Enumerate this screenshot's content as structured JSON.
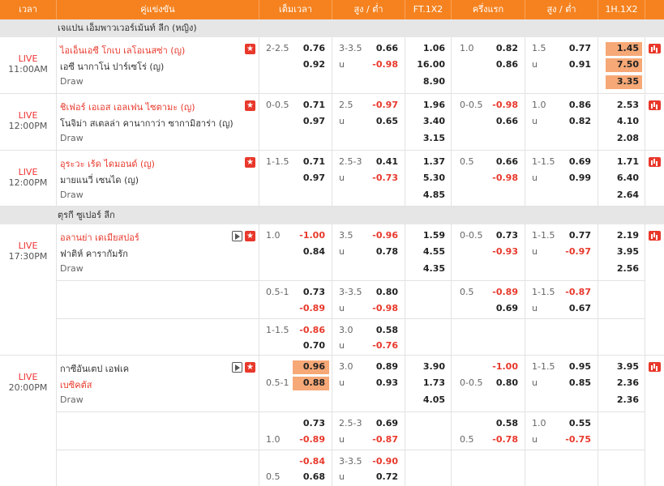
{
  "header": {
    "time": "เวลา",
    "match": "คู่แข่งขัน",
    "handicap": "เต็มเวลา",
    "ou": "สูง / ต่ำ",
    "ft1x2": "FT.1X2",
    "half": "ครึ่งแรก",
    "ou_half": "สูง / ต่ำ",
    "h1x2": "1H.1X2"
  },
  "leagues": [
    "เจแปน เอ็มพาวเวอร์เม้นท์ ลีก (หญิง)",
    "ตุรกี ซูเปอร์ ลีก"
  ],
  "live": "LIVE",
  "draw": "Draw",
  "under": "u",
  "m1": {
    "time": "11:00AM",
    "home": "ไอเอ็นเอซี โกเบ เลโอเนสซ่า (ญ)",
    "away": "เอซี นากาโน่ ปาร์เซโร่ (ญ)",
    "hdp": "2-2.5",
    "hdp_h": "0.76",
    "hdp_a": "0.92",
    "ou": "3-3.5",
    "ou_o": "0.66",
    "ou_u": "-0.98",
    "ft_h": "1.06",
    "ft_a": "16.00",
    "ft_d": "8.90",
    "hhdp": "1.0",
    "hhdp_h": "0.82",
    "hhdp_a": "0.86",
    "hou": "1.5",
    "hou_o": "0.77",
    "hou_u": "0.91",
    "h_h": "1.45",
    "h_a": "7.50",
    "h_d": "3.35"
  },
  "m2": {
    "time": "12:00PM",
    "home": "ชิเฟอร์ เอเอส เอลเฟน ไซตามะ (ญ)",
    "away": "โนจิม่า สเตลล่า คานากาว่า ซากามิฮาร่า (ญ)",
    "hdp": "0-0.5",
    "hdp_h": "0.71",
    "hdp_a": "0.97",
    "ou": "2.5",
    "ou_o": "-0.97",
    "ou_u": "0.65",
    "ft_h": "1.96",
    "ft_a": "3.40",
    "ft_d": "3.15",
    "hhdp": "0-0.5",
    "hhdp_h": "-0.98",
    "hhdp_a": "0.66",
    "hou": "1.0",
    "hou_o": "0.86",
    "hou_u": "0.82",
    "h_h": "2.53",
    "h_a": "4.10",
    "h_d": "2.08"
  },
  "m3": {
    "time": "12:00PM",
    "home": "อุระวะ เร้ด ไดมอนด์ (ญ)",
    "away": "มายแนวี่ เซนได (ญ)",
    "hdp": "1-1.5",
    "hdp_h": "0.71",
    "hdp_a": "0.97",
    "ou": "2.5-3",
    "ou_o": "0.41",
    "ou_u": "-0.73",
    "ft_h": "1.37",
    "ft_a": "5.30",
    "ft_d": "4.85",
    "hhdp": "0.5",
    "hhdp_h": "0.66",
    "hhdp_a": "-0.98",
    "hou": "1-1.5",
    "hou_o": "0.69",
    "hou_u": "0.99",
    "h_h": "1.71",
    "h_a": "6.40",
    "h_d": "2.64"
  },
  "m4": {
    "time": "17:30PM",
    "home": "อลานย่า เดเมียสปอร์",
    "away": "ฟาติห์ คารากัมรัก",
    "hdp": "1.0",
    "hdp_h": "-1.00",
    "hdp_a": "0.84",
    "ou": "3.5",
    "ou_o": "-0.96",
    "ou_u": "0.78",
    "ft_h": "1.59",
    "ft_a": "4.55",
    "ft_d": "4.35",
    "hhdp": "0-0.5",
    "hhdp_h": "0.73",
    "hhdp_a": "-0.93",
    "hou": "1-1.5",
    "hou_o": "0.77",
    "hou_u": "-0.97",
    "h_h": "2.19",
    "h_a": "3.95",
    "h_d": "2.56",
    "x1": {
      "hdp": "0.5-1",
      "hdp_h": "0.73",
      "hdp_a": "-0.89",
      "ou": "3-3.5",
      "ou_o": "0.80",
      "ou_u": "-0.98",
      "hhdp": "0.5",
      "hhdp_h": "-0.89",
      "hhdp_a": "0.69",
      "hou": "1-1.5",
      "hou_o": "-0.87",
      "hou_u": "0.67"
    },
    "x2": {
      "hdp": "1-1.5",
      "hdp_h": "-0.86",
      "hdp_a": "0.70",
      "ou": "3.0",
      "ou_o": "0.58",
      "ou_u": "-0.76"
    }
  },
  "m5": {
    "time": "20:00PM",
    "home": "กาซีอันเตป เอฟเค",
    "away": "เบซิคตัส",
    "hdp": "0.5-1",
    "hdp_h": "0.96",
    "hdp_a": "0.88",
    "ou": "3.0",
    "ou_o": "0.89",
    "ou_u": "0.93",
    "ft_h": "3.90",
    "ft_a": "1.73",
    "ft_d": "4.05",
    "hhdp": "0-0.5",
    "hhdp_h": "-1.00",
    "hhdp_a": "0.80",
    "hou": "1-1.5",
    "hou_o": "0.95",
    "hou_u": "0.85",
    "h_h": "3.95",
    "h_a": "2.36",
    "h_d": "2.36",
    "x1": {
      "hdp": "1.0",
      "hdp_h": "0.73",
      "hdp_a": "-0.89",
      "ou": "2.5-3",
      "ou_o": "0.69",
      "ou_u": "-0.87",
      "hhdp": "0.5",
      "hhdp_h": "0.58",
      "hhdp_a": "-0.78",
      "hou": "1.0",
      "hou_o": "0.55",
      "hou_u": "-0.75"
    },
    "x2": {
      "hdp": "0.5",
      "hdp_h": "-0.84",
      "hdp_a": "0.68",
      "ou": "3-3.5",
      "ou_o": "-0.90",
      "ou_u": "0.72"
    }
  }
}
